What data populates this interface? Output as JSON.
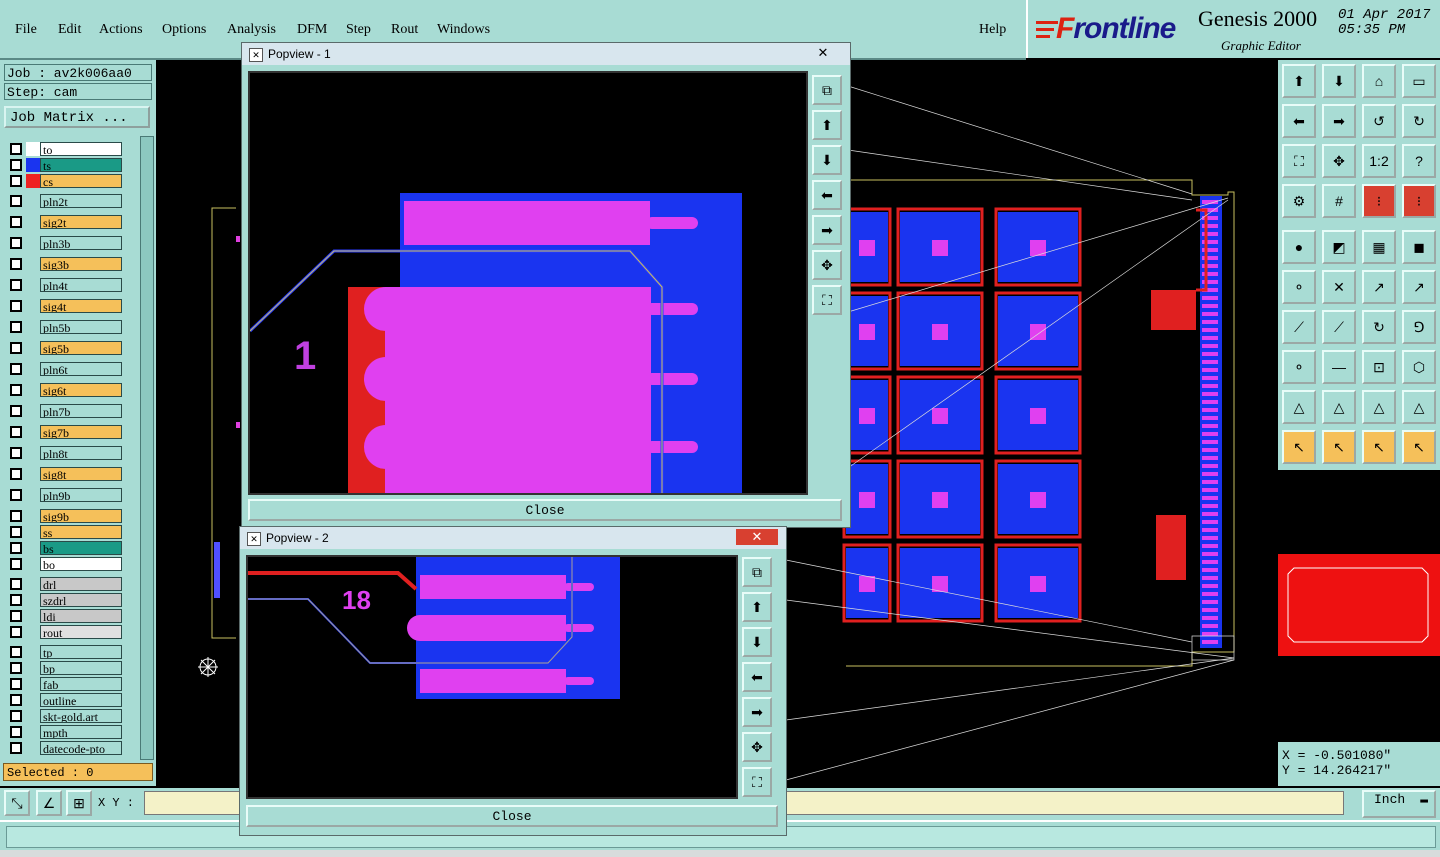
{
  "menu": {
    "file": "File",
    "edit": "Edit",
    "actions": "Actions",
    "options": "Options",
    "analysis": "Analysis",
    "dfm": "DFM",
    "step": "Step",
    "rout": "Rout",
    "windows": "Windows",
    "help": "Help"
  },
  "brand": {
    "logo_prefix": "F",
    "logo_rest": "rontline",
    "product": "Genesis 2000",
    "subtitle": "Graphic Editor",
    "date": "01 Apr 2017",
    "time": "05:35 PM"
  },
  "job": {
    "job_label": "Job : av2k006aa0",
    "step_label": "Step: cam",
    "matrix_button": "Job Matrix ..."
  },
  "layers": [
    {
      "name": "to",
      "color": "#ffffff",
      "sw": "#ffffff"
    },
    {
      "name": "ts",
      "color": "#1a9a86",
      "sw": "#1a34f0"
    },
    {
      "name": "cs",
      "color": "#f5c05a",
      "sw": "#ee2222"
    },
    {
      "name": "pln2t",
      "color": "#a8dcd4",
      "sw": "#a8dcd4"
    },
    {
      "name": "sig2t",
      "color": "#f5c05a",
      "sw": "#a8dcd4"
    },
    {
      "name": "pln3b",
      "color": "#a8dcd4",
      "sw": "#a8dcd4"
    },
    {
      "name": "sig3b",
      "color": "#f5c05a",
      "sw": "#a8dcd4"
    },
    {
      "name": "pln4t",
      "color": "#a8dcd4",
      "sw": "#a8dcd4"
    },
    {
      "name": "sig4t",
      "color": "#f5c05a",
      "sw": "#a8dcd4"
    },
    {
      "name": "pln5b",
      "color": "#a8dcd4",
      "sw": "#a8dcd4"
    },
    {
      "name": "sig5b",
      "color": "#f5c05a",
      "sw": "#a8dcd4"
    },
    {
      "name": "pln6t",
      "color": "#a8dcd4",
      "sw": "#a8dcd4"
    },
    {
      "name": "sig6t",
      "color": "#f5c05a",
      "sw": "#a8dcd4"
    },
    {
      "name": "pln7b",
      "color": "#a8dcd4",
      "sw": "#a8dcd4"
    },
    {
      "name": "sig7b",
      "color": "#f5c05a",
      "sw": "#a8dcd4"
    },
    {
      "name": "pln8t",
      "color": "#a8dcd4",
      "sw": "#a8dcd4"
    },
    {
      "name": "sig8t",
      "color": "#f5c05a",
      "sw": "#a8dcd4"
    },
    {
      "name": "pln9b",
      "color": "#a8dcd4",
      "sw": "#a8dcd4"
    },
    {
      "name": "sig9b",
      "color": "#f5c05a",
      "sw": "#a8dcd4"
    },
    {
      "name": "ss",
      "color": "#f5c05a",
      "sw": "#a8dcd4"
    },
    {
      "name": "bs",
      "color": "#1a9a86",
      "sw": "#a8dcd4"
    },
    {
      "name": "bo",
      "color": "#ffffff",
      "sw": "#a8dcd4"
    },
    {
      "name": "drl",
      "color": "#c8c8c8",
      "sw": "#a8dcd4"
    },
    {
      "name": "szdrl",
      "color": "#c8c8c8",
      "sw": "#a8dcd4"
    },
    {
      "name": "ldi",
      "color": "#c8c8c8",
      "sw": "#a8dcd4"
    },
    {
      "name": "rout",
      "color": "#e0e0e0",
      "sw": "#a8dcd4"
    },
    {
      "name": "tp",
      "color": "#a8dcd4",
      "sw": "#a8dcd4"
    },
    {
      "name": "bp",
      "color": "#a8dcd4",
      "sw": "#a8dcd4"
    },
    {
      "name": "fab",
      "color": "#a8dcd4",
      "sw": "#a8dcd4"
    },
    {
      "name": "outline",
      "color": "#a8dcd4",
      "sw": "#a8dcd4"
    },
    {
      "name": "skt-gold.art",
      "color": "#a8dcd4",
      "sw": "#a8dcd4"
    },
    {
      "name": "mpth",
      "color": "#a8dcd4",
      "sw": "#a8dcd4"
    },
    {
      "name": "datecode-pto",
      "color": "#a8dcd4",
      "sw": "#a8dcd4"
    }
  ],
  "selected_label": "Selected : 0",
  "xy": {
    "label": "X Y :",
    "value": ""
  },
  "units": "Inch",
  "coords": {
    "x": "X = -0.501080\"",
    "y": "Y = 14.264217\""
  },
  "popup1": {
    "title": "Popview - 1",
    "close": "Close",
    "close_x": "✕",
    "pin_label": "1"
  },
  "popup2": {
    "title": "Popview - 2",
    "close": "Close",
    "close_x": "✕",
    "pin_label": "18"
  }
}
